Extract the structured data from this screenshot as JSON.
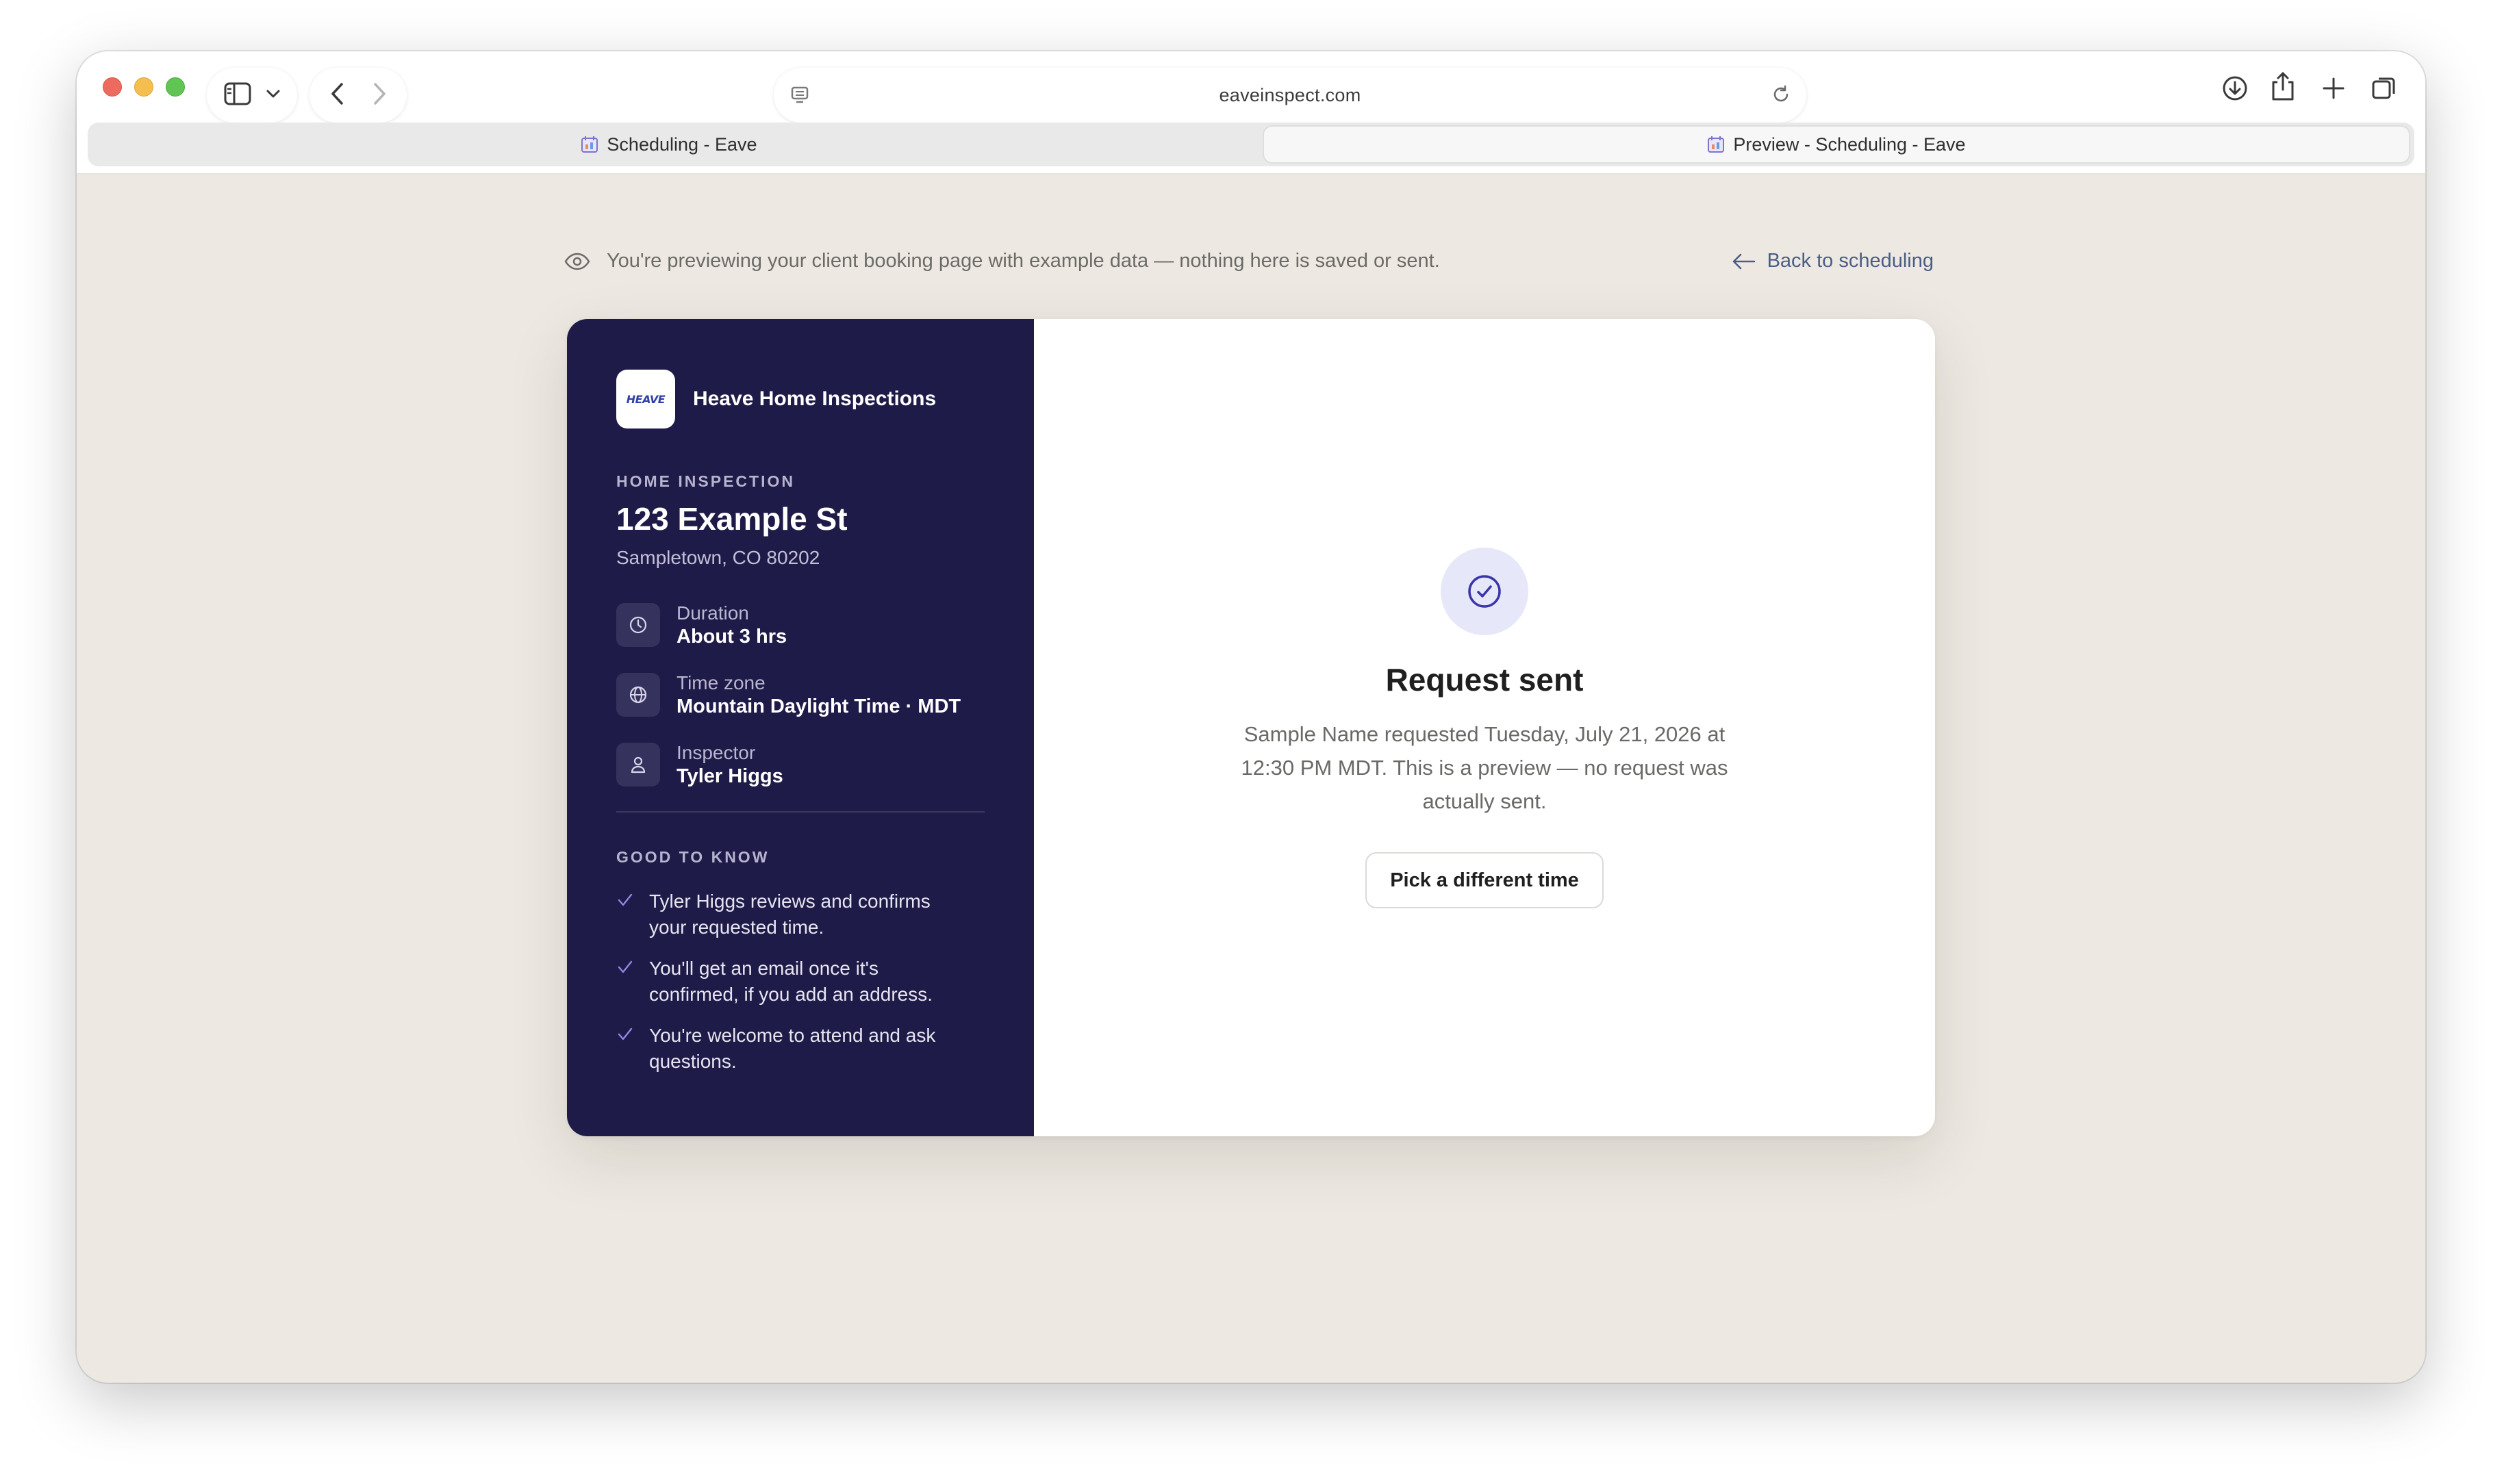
{
  "browser": {
    "url": "eaveinspect.com",
    "tabs": [
      {
        "label": "Scheduling - Eave",
        "active": false
      },
      {
        "label": "Preview - Scheduling - Eave",
        "active": true
      }
    ],
    "icons": [
      "sidebar-icon",
      "chevron-down-icon",
      "back-icon",
      "forward-icon",
      "reader-icon",
      "reload-icon",
      "download-icon",
      "share-icon",
      "new-tab-icon",
      "tab-overview-icon"
    ]
  },
  "preview_banner": {
    "text": "You're previewing your client booking page with example data — nothing here is saved or sent.",
    "back_label": "Back to scheduling"
  },
  "sidebar": {
    "logo_text": "HEAVE",
    "company": "Heave Home Inspections",
    "eyebrow": "HOME INSPECTION",
    "address": "123 Example St",
    "city": "Sampletown, CO 80202",
    "details": [
      {
        "icon": "clock-icon",
        "label": "Duration",
        "value": "About 3 hrs"
      },
      {
        "icon": "globe-icon",
        "label": "Time zone",
        "value": "Mountain Daylight Time · MDT"
      },
      {
        "icon": "person-icon",
        "label": "Inspector",
        "value": "Tyler Higgs"
      }
    ],
    "good_to_know_title": "GOOD TO KNOW",
    "good_to_know": [
      "Tyler Higgs reviews and confirms your requested time.",
      "You'll get an email once it's confirmed, if you add an address.",
      "You're welcome to attend and ask questions."
    ]
  },
  "confirmation": {
    "title": "Request sent",
    "message": "Sample Name requested Tuesday, July 21, 2026 at 12:30 PM MDT. This is a preview — no request was actually sent.",
    "button_label": "Pick a different time"
  },
  "colors": {
    "sidebar_bg": "#1e1b48",
    "page_bg": "#ede9e2",
    "accent": "#3b35a8",
    "link": "#4a5d86"
  }
}
